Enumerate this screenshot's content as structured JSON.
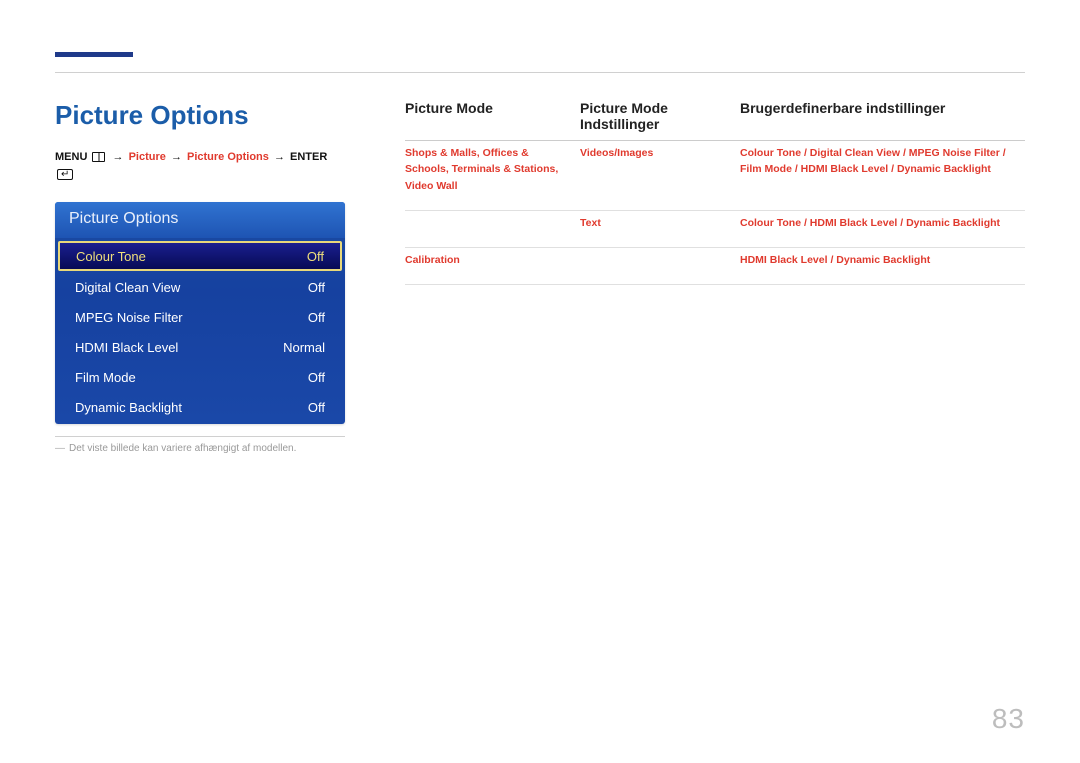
{
  "title": "Picture Options",
  "breadcrumb": {
    "menu": "MENU",
    "p1": "Picture",
    "p2": "Picture Options",
    "enter": "ENTER"
  },
  "osd": {
    "header": "Picture Options",
    "items": [
      {
        "label": "Colour Tone",
        "value": "Off",
        "selected": true
      },
      {
        "label": "Digital Clean View",
        "value": "Off",
        "selected": false
      },
      {
        "label": "MPEG Noise Filter",
        "value": "Off",
        "selected": false
      },
      {
        "label": "HDMI Black Level",
        "value": "Normal",
        "selected": false
      },
      {
        "label": "Film Mode",
        "value": "Off",
        "selected": false
      },
      {
        "label": "Dynamic Backlight",
        "value": "Off",
        "selected": false
      }
    ]
  },
  "note": "Det viste billede kan variere afhængigt af modellen.",
  "table": {
    "headers": {
      "col1": "Picture Mode",
      "col2": "Picture Mode Indstillinger",
      "col3": "Brugerdefinerbare indstillinger"
    },
    "rows": [
      {
        "col1": "Shops & Malls, Offices & Schools, Terminals & Stations, Video Wall",
        "col2": "Videos/Images",
        "col3": "Colour Tone / Digital Clean View / MPEG Noise Filter / Film Mode / HDMI Black Level / Dynamic Backlight"
      },
      {
        "col1": "",
        "col2": "Text",
        "col3": "Colour Tone / HDMI Black Level / Dynamic Backlight"
      },
      {
        "col1": "Calibration",
        "col2": "",
        "col3": "HDMI Black Level / Dynamic Backlight"
      }
    ]
  },
  "page_number": "83"
}
